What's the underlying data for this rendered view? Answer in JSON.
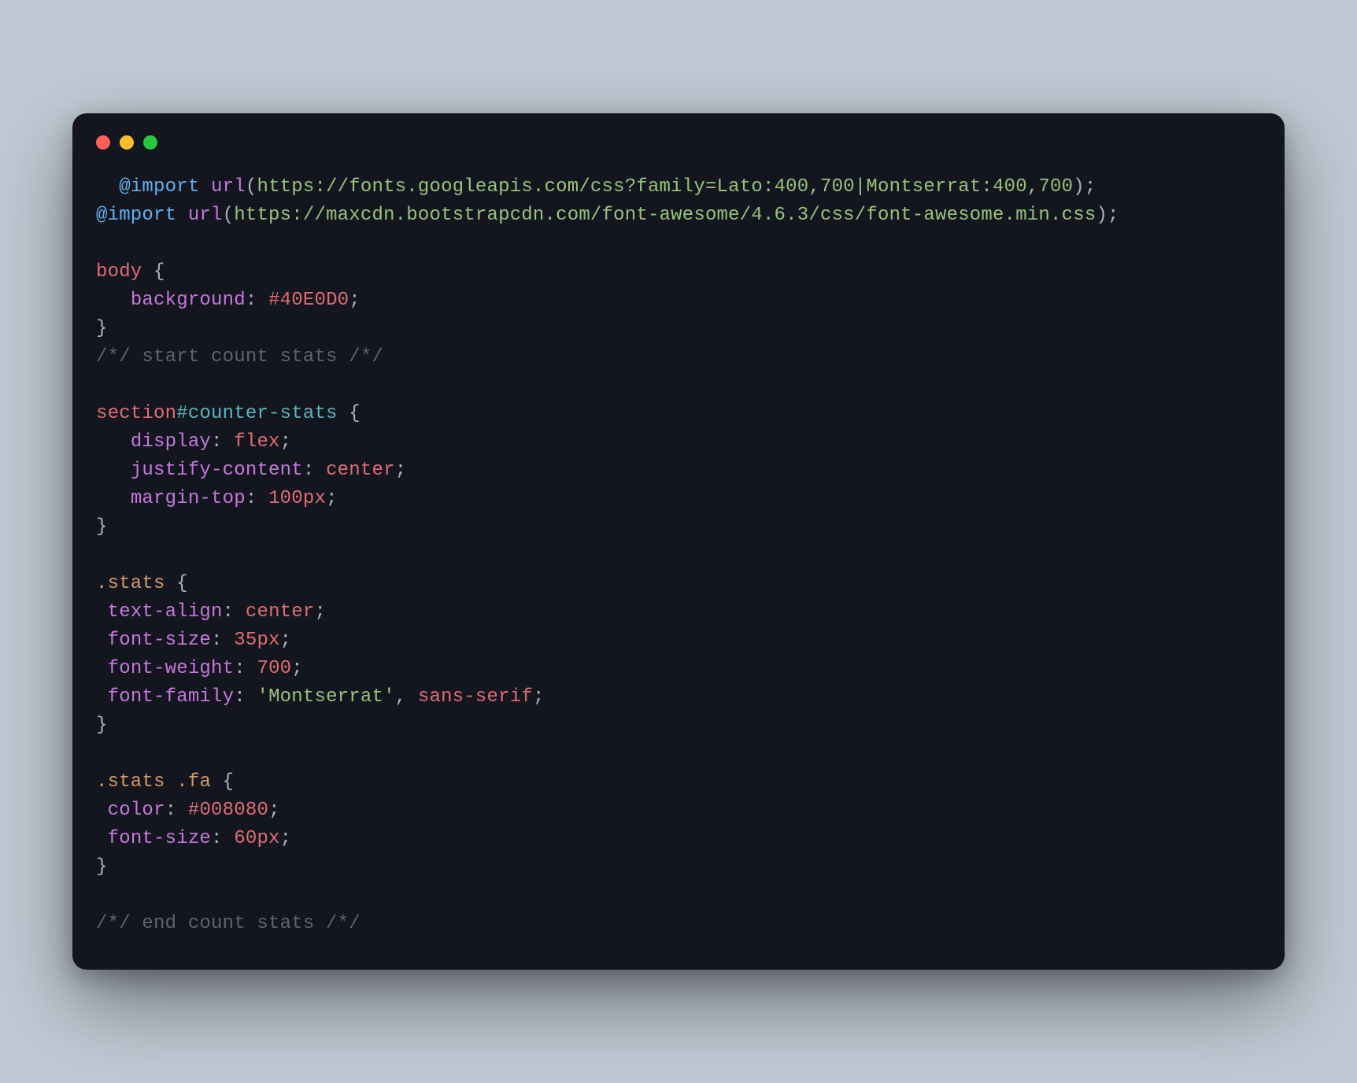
{
  "titlebar": {
    "buttons": [
      "close",
      "minimize",
      "zoom"
    ]
  },
  "code": {
    "indent1": "  ",
    "indent2": "   ",
    "import1_kw": "@import",
    "import1_fn": "url",
    "import1_url": "https://fonts.googleapis.com/css?family=Lato:400,700|Montserrat:400,700",
    "import2_kw": "@import",
    "import2_fn": "url",
    "import2_url": "https://maxcdn.bootstrapcdn.com/font-awesome/4.6.3/css/font-awesome.min.css",
    "body_sel": "body",
    "body_prop1": "background",
    "body_val1": "#40E0D0",
    "comment_start": "/*/ start count stats /*/",
    "sec_tag": "section",
    "sec_id": "#counter-stats",
    "sec_prop1": "display",
    "sec_val1": "flex",
    "sec_prop2": "justify-content",
    "sec_val2": "center",
    "sec_prop3": "margin-top",
    "sec_val3": "100px",
    "stats_sel": ".stats",
    "stats_prop1": "text-align",
    "stats_val1": "center",
    "stats_prop2": "font-size",
    "stats_val2": "35px",
    "stats_prop3": "font-weight",
    "stats_val3": "700",
    "stats_prop4": "font-family",
    "stats_val4": "'Montserrat'",
    "stats_val4b": "sans-serif",
    "fa_sel1": ".stats",
    "fa_sel2": ".fa",
    "fa_prop1": "color",
    "fa_val1": "#008080",
    "fa_prop2": "font-size",
    "fa_val2": "60px",
    "comment_end": "/*/ end count stats /*/"
  }
}
